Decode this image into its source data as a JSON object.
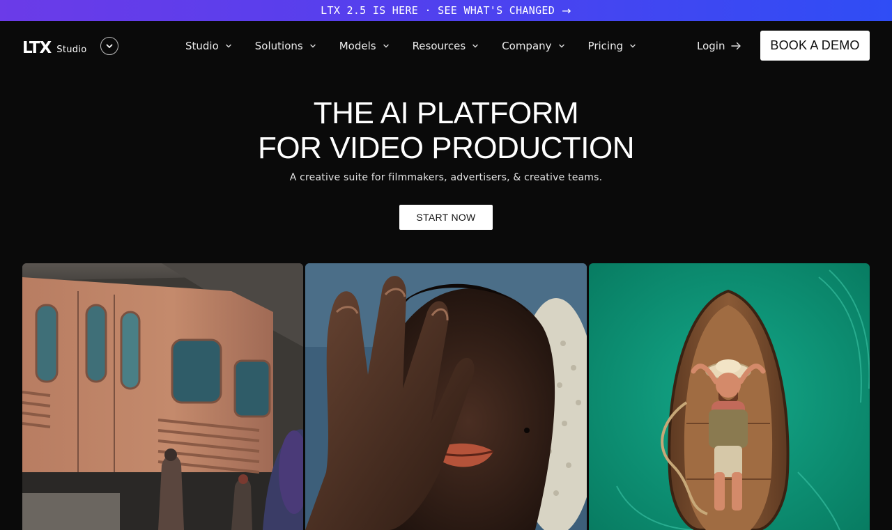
{
  "announcement": {
    "text": "LTX 2.5 IS HERE · SEE WHAT'S CHANGED",
    "arrow": "→"
  },
  "brand": {
    "logo": "LTX",
    "product": "Studio"
  },
  "nav": {
    "items": [
      {
        "label": "Studio"
      },
      {
        "label": "Solutions"
      },
      {
        "label": "Models"
      },
      {
        "label": "Resources"
      },
      {
        "label": "Company"
      },
      {
        "label": "Pricing"
      }
    ],
    "login": "Login",
    "book_demo": "BOOK A DEMO"
  },
  "hero": {
    "title_line1": "THE AI PLATFORM",
    "title_line2": "FOR VIDEO PRODUCTION",
    "subtitle": "A creative suite for filmmakers, advertisers, & creative teams.",
    "cta": "START NOW"
  },
  "colors": {
    "background": "#0a0a0a",
    "banner_start": "#6b3be8",
    "banner_end": "#2f4df5",
    "button_bg": "#ffffff"
  }
}
